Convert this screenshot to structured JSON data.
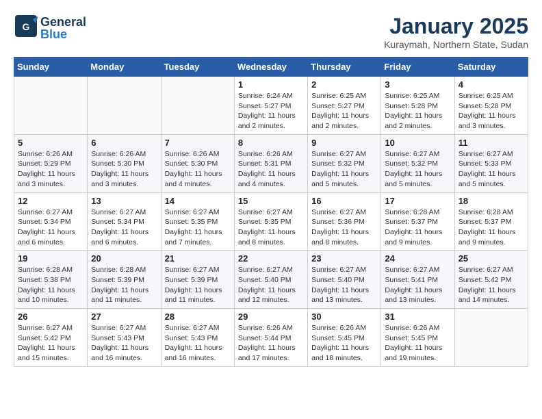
{
  "header": {
    "logo_general": "General",
    "logo_blue": "Blue",
    "title": "January 2025",
    "subtitle": "Kuraymah, Northern State, Sudan"
  },
  "days_of_week": [
    "Sunday",
    "Monday",
    "Tuesday",
    "Wednesday",
    "Thursday",
    "Friday",
    "Saturday"
  ],
  "weeks": [
    [
      {
        "day": "",
        "info": ""
      },
      {
        "day": "",
        "info": ""
      },
      {
        "day": "",
        "info": ""
      },
      {
        "day": "1",
        "info": "Sunrise: 6:24 AM\nSunset: 5:27 PM\nDaylight: 11 hours\nand 2 minutes."
      },
      {
        "day": "2",
        "info": "Sunrise: 6:25 AM\nSunset: 5:27 PM\nDaylight: 11 hours\nand 2 minutes."
      },
      {
        "day": "3",
        "info": "Sunrise: 6:25 AM\nSunset: 5:28 PM\nDaylight: 11 hours\nand 2 minutes."
      },
      {
        "day": "4",
        "info": "Sunrise: 6:25 AM\nSunset: 5:28 PM\nDaylight: 11 hours\nand 3 minutes."
      }
    ],
    [
      {
        "day": "5",
        "info": "Sunrise: 6:26 AM\nSunset: 5:29 PM\nDaylight: 11 hours\nand 3 minutes."
      },
      {
        "day": "6",
        "info": "Sunrise: 6:26 AM\nSunset: 5:30 PM\nDaylight: 11 hours\nand 3 minutes."
      },
      {
        "day": "7",
        "info": "Sunrise: 6:26 AM\nSunset: 5:30 PM\nDaylight: 11 hours\nand 4 minutes."
      },
      {
        "day": "8",
        "info": "Sunrise: 6:26 AM\nSunset: 5:31 PM\nDaylight: 11 hours\nand 4 minutes."
      },
      {
        "day": "9",
        "info": "Sunrise: 6:27 AM\nSunset: 5:32 PM\nDaylight: 11 hours\nand 5 minutes."
      },
      {
        "day": "10",
        "info": "Sunrise: 6:27 AM\nSunset: 5:32 PM\nDaylight: 11 hours\nand 5 minutes."
      },
      {
        "day": "11",
        "info": "Sunrise: 6:27 AM\nSunset: 5:33 PM\nDaylight: 11 hours\nand 5 minutes."
      }
    ],
    [
      {
        "day": "12",
        "info": "Sunrise: 6:27 AM\nSunset: 5:34 PM\nDaylight: 11 hours\nand 6 minutes."
      },
      {
        "day": "13",
        "info": "Sunrise: 6:27 AM\nSunset: 5:34 PM\nDaylight: 11 hours\nand 6 minutes."
      },
      {
        "day": "14",
        "info": "Sunrise: 6:27 AM\nSunset: 5:35 PM\nDaylight: 11 hours\nand 7 minutes."
      },
      {
        "day": "15",
        "info": "Sunrise: 6:27 AM\nSunset: 5:35 PM\nDaylight: 11 hours\nand 8 minutes."
      },
      {
        "day": "16",
        "info": "Sunrise: 6:27 AM\nSunset: 5:36 PM\nDaylight: 11 hours\nand 8 minutes."
      },
      {
        "day": "17",
        "info": "Sunrise: 6:28 AM\nSunset: 5:37 PM\nDaylight: 11 hours\nand 9 minutes."
      },
      {
        "day": "18",
        "info": "Sunrise: 6:28 AM\nSunset: 5:37 PM\nDaylight: 11 hours\nand 9 minutes."
      }
    ],
    [
      {
        "day": "19",
        "info": "Sunrise: 6:28 AM\nSunset: 5:38 PM\nDaylight: 11 hours\nand 10 minutes."
      },
      {
        "day": "20",
        "info": "Sunrise: 6:28 AM\nSunset: 5:39 PM\nDaylight: 11 hours\nand 11 minutes."
      },
      {
        "day": "21",
        "info": "Sunrise: 6:27 AM\nSunset: 5:39 PM\nDaylight: 11 hours\nand 11 minutes."
      },
      {
        "day": "22",
        "info": "Sunrise: 6:27 AM\nSunset: 5:40 PM\nDaylight: 11 hours\nand 12 minutes."
      },
      {
        "day": "23",
        "info": "Sunrise: 6:27 AM\nSunset: 5:40 PM\nDaylight: 11 hours\nand 13 minutes."
      },
      {
        "day": "24",
        "info": "Sunrise: 6:27 AM\nSunset: 5:41 PM\nDaylight: 11 hours\nand 13 minutes."
      },
      {
        "day": "25",
        "info": "Sunrise: 6:27 AM\nSunset: 5:42 PM\nDaylight: 11 hours\nand 14 minutes."
      }
    ],
    [
      {
        "day": "26",
        "info": "Sunrise: 6:27 AM\nSunset: 5:42 PM\nDaylight: 11 hours\nand 15 minutes."
      },
      {
        "day": "27",
        "info": "Sunrise: 6:27 AM\nSunset: 5:43 PM\nDaylight: 11 hours\nand 16 minutes."
      },
      {
        "day": "28",
        "info": "Sunrise: 6:27 AM\nSunset: 5:43 PM\nDaylight: 11 hours\nand 16 minutes."
      },
      {
        "day": "29",
        "info": "Sunrise: 6:26 AM\nSunset: 5:44 PM\nDaylight: 11 hours\nand 17 minutes."
      },
      {
        "day": "30",
        "info": "Sunrise: 6:26 AM\nSunset: 5:45 PM\nDaylight: 11 hours\nand 18 minutes."
      },
      {
        "day": "31",
        "info": "Sunrise: 6:26 AM\nSunset: 5:45 PM\nDaylight: 11 hours\nand 19 minutes."
      },
      {
        "day": "",
        "info": ""
      }
    ]
  ]
}
